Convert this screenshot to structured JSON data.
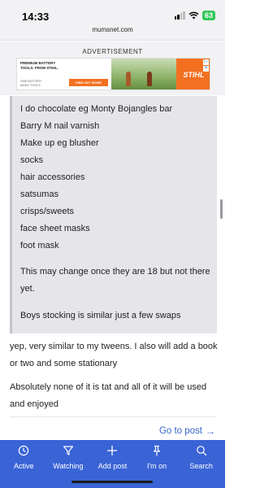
{
  "status_bar": {
    "time": "14:33",
    "battery": "63"
  },
  "url_bar": {
    "domain": "mumsnet.com"
  },
  "advertisement": {
    "label": "ADVERTISEMENT",
    "headline": "PREMIUM BATTERY TOOLS. FROM STIHL.",
    "subtext": "ONE BATTERY MANY TOOLS",
    "cta": "FIND OUT MORE",
    "brand": "STIHL"
  },
  "quote": {
    "list_items": [
      "I do chocolate eg Monty Bojangles bar",
      "Barry M nail varnish",
      "Make up eg blusher",
      "socks",
      "hair accessories",
      "satsumas",
      "crisps/sweets",
      "face sheet masks",
      "foot mask"
    ],
    "paragraph_1": "This may change once they are 18 but not there yet.",
    "paragraph_2": "Boys stocking is similar just a few swaps"
  },
  "reply": {
    "paragraph_1": "yep, very similar to my tweens. I also will add a book or two and some stationary",
    "paragraph_2": "Absolutely none of it is tat and all of it will be used and enjoyed"
  },
  "goto_post": {
    "label": "Go to post"
  },
  "bottom_nav": [
    {
      "label": "Active",
      "icon": "clock-icon"
    },
    {
      "label": "Watching",
      "icon": "filter-icon"
    },
    {
      "label": "Add post",
      "icon": "plus-icon"
    },
    {
      "label": "I'm on",
      "icon": "pin-icon"
    },
    {
      "label": "Search",
      "icon": "search-icon"
    }
  ],
  "colors": {
    "nav_background": "#3a63d6",
    "link": "#3566c9",
    "quote_background": "#e6e6ea",
    "battery": "#34c759",
    "stihl_orange": "#f37021"
  }
}
